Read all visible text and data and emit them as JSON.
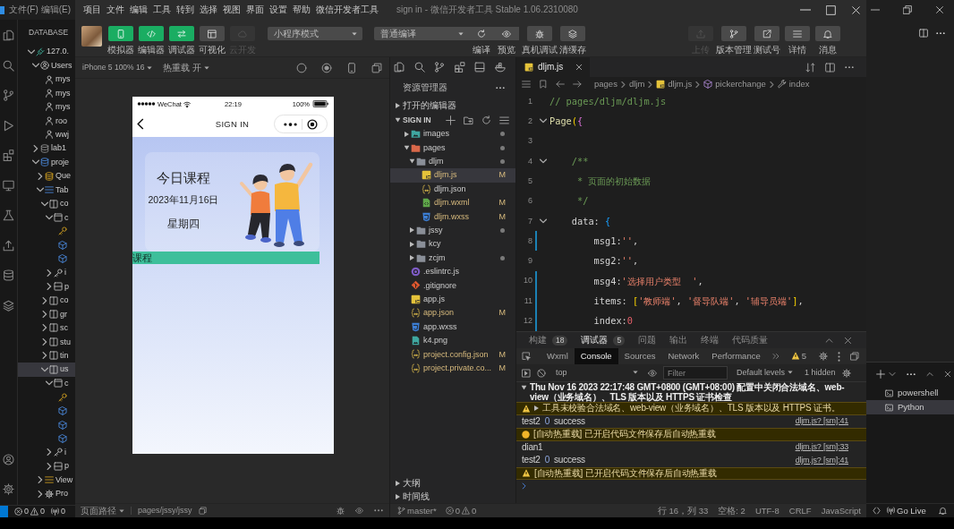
{
  "vscode": {
    "menu": [
      "文件(F)",
      "编辑(E)"
    ],
    "sidebar": {
      "title": "DATABASE",
      "tree": [
        {
          "label": "127.0.",
          "kind": "server",
          "expanded": true,
          "selected": false,
          "children": [
            {
              "label": "Users",
              "kind": "users",
              "expanded": true,
              "selected": false,
              "children": [
                {
                  "label": "mys",
                  "kind": "user",
                  "selected": false
                },
                {
                  "label": "mys",
                  "kind": "user",
                  "selected": false
                },
                {
                  "label": "mys",
                  "kind": "user",
                  "selected": false
                },
                {
                  "label": "roo",
                  "kind": "user",
                  "selected": false
                },
                {
                  "label": "wwj",
                  "kind": "user",
                  "selected": false
                }
              ]
            },
            {
              "label": "lab1",
              "kind": "database",
              "expanded": false,
              "selected": false
            },
            {
              "label": "proje",
              "kind": "schema",
              "expanded": true,
              "selected": false,
              "children": [
                {
                  "label": "Que",
                  "kind": "queries",
                  "expanded": false,
                  "selected": false
                },
                {
                  "label": "Tab",
                  "kind": "tables",
                  "expanded": true,
                  "selected": false,
                  "children": [
                    {
                      "label": "co",
                      "kind": "table",
                      "expanded": true,
                      "selected": false,
                      "children": [
                        {
                          "label": "c",
                          "kind": "columns",
                          "expanded": true,
                          "selected": false,
                          "children": [
                            {
                              "kind": "key",
                              "selected": false
                            },
                            {
                              "kind": "column",
                              "selected": false
                            },
                            {
                              "kind": "column",
                              "selected": false
                            }
                          ]
                        },
                        {
                          "label": "i",
                          "kind": "index",
                          "expanded": false,
                          "selected": false
                        },
                        {
                          "label": "p",
                          "kind": "partition",
                          "expanded": false,
                          "selected": false
                        }
                      ]
                    },
                    {
                      "label": "co",
                      "kind": "table",
                      "expanded": false,
                      "selected": false
                    },
                    {
                      "label": "gr",
                      "kind": "table",
                      "expanded": false,
                      "selected": false
                    },
                    {
                      "label": "sc",
                      "kind": "table",
                      "expanded": false,
                      "selected": false
                    },
                    {
                      "label": "stu",
                      "kind": "table",
                      "expanded": false,
                      "selected": false
                    },
                    {
                      "label": "tin",
                      "kind": "table",
                      "expanded": false,
                      "selected": false
                    },
                    {
                      "label": "us",
                      "kind": "table",
                      "expanded": true,
                      "selected": true,
                      "children": [
                        {
                          "label": "c",
                          "kind": "columns",
                          "expanded": true,
                          "selected": false,
                          "children": [
                            {
                              "kind": "key",
                              "selected": false
                            },
                            {
                              "kind": "column",
                              "selected": false
                            },
                            {
                              "kind": "column",
                              "selected": false
                            },
                            {
                              "kind": "column",
                              "selected": false
                            }
                          ]
                        },
                        {
                          "label": "i",
                          "kind": "index",
                          "expanded": false,
                          "selected": false
                        },
                        {
                          "label": "p",
                          "kind": "partition",
                          "expanded": false,
                          "selected": false
                        }
                      ]
                    }
                  ]
                },
                {
                  "label": "View",
                  "kind": "views",
                  "expanded": false,
                  "selected": false
                },
                {
                  "label": "Pro",
                  "kind": "procedures",
                  "expanded": false,
                  "selected": false
                }
              ]
            }
          ]
        }
      ]
    },
    "status": {
      "errors": "0",
      "warnings": "0",
      "ports": "0"
    },
    "panel": {
      "terminals": [
        {
          "label": "powershell",
          "selected": false
        },
        {
          "label": "Python",
          "selected": true
        }
      ]
    },
    "go_live": "Go Live"
  },
  "devtools": {
    "menu": [
      "项目",
      "文件",
      "编辑",
      "工具",
      "转到",
      "选择",
      "视图",
      "界面",
      "设置",
      "帮助",
      "微信开发者工具"
    ],
    "title": "sign in - 微信开发者工具 Stable 1.06.2310080",
    "toolbar": {
      "views": [
        {
          "label": "模拟器",
          "kind": "phone",
          "on": true,
          "disabled": false
        },
        {
          "label": "编辑器",
          "kind": "code",
          "on": true,
          "disabled": false
        },
        {
          "label": "调试器",
          "kind": "debug",
          "on": true,
          "disabled": false
        },
        {
          "label": "可视化",
          "kind": "layout",
          "on": false,
          "disabled": false
        },
        {
          "label": "云开发",
          "kind": "cloud",
          "on": false,
          "disabled": true
        }
      ],
      "mode": "小程序模式",
      "compile": {
        "label": "普通编译",
        "actions": [
          {
            "label": "编译",
            "kind": "refresh"
          },
          {
            "label": "预览",
            "kind": "eye"
          }
        ]
      },
      "actions": [
        {
          "label": "真机调试",
          "kind": "bug"
        },
        {
          "label": "清缓存",
          "kind": "layers"
        }
      ],
      "right": [
        {
          "label": "上传",
          "kind": "upload",
          "disabled": true
        },
        {
          "label": "版本管理",
          "kind": "branch",
          "disabled": false
        },
        {
          "label": "测试号",
          "kind": "share",
          "disabled": false
        },
        {
          "label": "详情",
          "kind": "menu",
          "disabled": false
        },
        {
          "label": "消息",
          "kind": "bell",
          "disabled": false
        }
      ]
    },
    "simulator": {
      "device": "iPhone 5 100% 16",
      "hot_reload": "热重载 开",
      "phone": {
        "carrier": "WeChat",
        "time": "22:19",
        "battery": "100%",
        "title": "SIGN IN",
        "card": {
          "title": "今日课程",
          "date": "2023年11月16日",
          "weekday": "星期四"
        },
        "section": "课程"
      },
      "footer": {
        "label": "页面路径",
        "path": "pages/jssy/jssy"
      }
    },
    "explorer": {
      "title": "资源管理器",
      "open_editors": {
        "label": "打开的编辑器",
        "expanded": false
      },
      "project": {
        "label": "SIGN IN",
        "expanded": true,
        "tree": [
          {
            "label": "images",
            "kind": "assets",
            "expanded": false,
            "selected": false,
            "dot": true
          },
          {
            "label": "pages",
            "kind": "pages",
            "expanded": true,
            "selected": false,
            "dot": true,
            "children": [
              {
                "label": "dljm",
                "kind": "folder",
                "expanded": true,
                "selected": false,
                "dot": true,
                "children": [
                  {
                    "label": "dljm.js",
                    "kind": "js",
                    "selected": true,
                    "dot": false,
                    "status": "M"
                  },
                  {
                    "label": "dljm.json",
                    "kind": "json",
                    "selected": false,
                    "dot": false
                  },
                  {
                    "label": "dljm.wxml",
                    "kind": "wxml",
                    "selected": false,
                    "dot": false,
                    "status": "M"
                  },
                  {
                    "label": "dljm.wxss",
                    "kind": "wxss",
                    "selected": false,
                    "dot": false,
                    "status": "M"
                  }
                ]
              },
              {
                "label": "jssy",
                "kind": "folder",
                "expanded": false,
                "selected": false,
                "dot": true
              },
              {
                "label": "kcy",
                "kind": "folder",
                "expanded": false,
                "selected": false,
                "dot": false
              },
              {
                "label": "zcjm",
                "kind": "folder",
                "expanded": false,
                "selected": false,
                "dot": true
              }
            ]
          },
          {
            "label": ".eslintrc.js",
            "kind": "eslint",
            "selected": false,
            "dot": false
          },
          {
            "label": ".gitignore",
            "kind": "git",
            "selected": false,
            "dot": false
          },
          {
            "label": "app.js",
            "kind": "js",
            "selected": false,
            "dot": false
          },
          {
            "label": "app.json",
            "kind": "json",
            "selected": false,
            "dot": false,
            "status": "M"
          },
          {
            "label": "app.wxss",
            "kind": "wxss",
            "selected": false,
            "dot": false
          },
          {
            "label": "k4.png",
            "kind": "png",
            "selected": false,
            "dot": false
          },
          {
            "label": "project.config.json",
            "kind": "json",
            "selected": false,
            "dot": false,
            "status": "M"
          },
          {
            "label": "project.private.co...",
            "kind": "json",
            "selected": false,
            "dot": false,
            "status": "M"
          }
        ]
      },
      "outline": {
        "label": "大纲",
        "expanded": false
      },
      "timeline": {
        "label": "时间线",
        "expanded": false
      }
    },
    "editor": {
      "tab": {
        "label": "dljm.js",
        "kind": "js",
        "selected": true
      },
      "breadcrumb": [
        {
          "label": "pages",
          "kind": "folder"
        },
        {
          "label": "dljm",
          "kind": "folder"
        },
        {
          "label": "dljm.js",
          "kind": "js"
        },
        {
          "label": "pickerchange",
          "kind": "method"
        },
        {
          "label": "index",
          "kind": "property"
        }
      ],
      "lines": [
        {
          "number": "1",
          "fold": false,
          "changed": false,
          "tokens": [
            {
              "kind": "comment",
              "text": "// pages/dljm/dljm.js"
            }
          ]
        },
        {
          "number": "2",
          "fold": true,
          "changed": false,
          "tokens": [
            {
              "kind": "function",
              "text": "Page"
            },
            {
              "kind": "bracket1",
              "text": "("
            },
            {
              "kind": "bracket2",
              "text": "{"
            }
          ]
        },
        {
          "number": "3",
          "fold": false,
          "changed": false
        },
        {
          "number": "4",
          "fold": true,
          "changed": false,
          "tokens": [
            {
              "kind": "comment",
              "text": "    /**"
            }
          ]
        },
        {
          "number": "5",
          "fold": false,
          "changed": false,
          "tokens": [
            {
              "kind": "comment",
              "text": "     * 页面的初始数据"
            }
          ]
        },
        {
          "number": "6",
          "fold": false,
          "changed": false,
          "tokens": [
            {
              "kind": "comment",
              "text": "     */"
            }
          ]
        },
        {
          "number": "7",
          "fold": true,
          "changed": false,
          "tokens": [
            {
              "kind": "property",
              "text": "    data"
            },
            {
              "kind": "punctuation",
              "text": ": "
            },
            {
              "kind": "bracket3",
              "text": "{"
            }
          ]
        },
        {
          "number": "8",
          "fold": false,
          "changed": true,
          "tokens": [
            {
              "kind": "property",
              "text": "        msg1"
            },
            {
              "kind": "punctuation",
              "text": ":"
            },
            {
              "kind": "string",
              "text": "''"
            },
            {
              "kind": "punctuation",
              "text": ","
            }
          ]
        },
        {
          "number": "9",
          "fold": false,
          "changed": false,
          "tokens": [
            {
              "kind": "property",
              "text": "        msg2"
            },
            {
              "kind": "punctuation",
              "text": ":"
            },
            {
              "kind": "string",
              "text": "''"
            },
            {
              "kind": "punctuation",
              "text": ","
            }
          ]
        },
        {
          "number": "10",
          "fold": false,
          "changed": true,
          "tokens": [
            {
              "kind": "property",
              "text": "        msg4"
            },
            {
              "kind": "punctuation",
              "text": ":"
            },
            {
              "kind": "string",
              "text": "'选择用户类型  '"
            },
            {
              "kind": "punctuation",
              "text": ","
            }
          ]
        },
        {
          "number": "11",
          "fold": false,
          "changed": true,
          "tokens": [
            {
              "kind": "property",
              "text": "        items"
            },
            {
              "kind": "punctuation",
              "text": ": "
            },
            {
              "kind": "bracket1",
              "text": "["
            },
            {
              "kind": "string",
              "text": "'教师端'"
            },
            {
              "kind": "punctuation",
              "text": ", "
            },
            {
              "kind": "string",
              "text": "'督导队端'"
            },
            {
              "kind": "punctuation",
              "text": ", "
            },
            {
              "kind": "string",
              "text": "'辅导员端'"
            },
            {
              "kind": "bracket1",
              "text": "]"
            },
            {
              "kind": "punctuation",
              "text": ","
            }
          ]
        },
        {
          "number": "12",
          "fold": false,
          "changed": true,
          "tokens": [
            {
              "kind": "property",
              "text": "        index"
            },
            {
              "kind": "punctuation",
              "text": ":"
            },
            {
              "kind": "number",
              "text": "0"
            }
          ]
        }
      ]
    },
    "panel": {
      "tabs": [
        {
          "label": "构建",
          "count": "18",
          "selected": false
        },
        {
          "label": "调试器",
          "count": "5",
          "selected": true
        },
        {
          "label": "问题",
          "selected": false
        },
        {
          "label": "输出",
          "selected": false
        },
        {
          "label": "终端",
          "selected": false
        },
        {
          "label": "代码质量",
          "selected": false
        }
      ],
      "devtools_tabs": [
        {
          "label": "Wxml",
          "selected": false
        },
        {
          "label": "Console",
          "selected": true
        },
        {
          "label": "Sources",
          "selected": false
        },
        {
          "label": "Network",
          "selected": false
        },
        {
          "label": "Performance",
          "selected": false
        }
      ],
      "warnings": "5",
      "filter": {
        "context": "top",
        "placeholder": "Filter",
        "levels": "Default levels",
        "hidden": "1 hidden"
      },
      "console": [
        {
          "kind": "group",
          "expanded": true,
          "text": "Thu Nov 16 2023 22:17:48 GMT+0800 (GMT+08:00) 配置中关闭合法域名、web-view（业务域名）、TLS 版本以及 HTTPS 证书检查"
        },
        {
          "kind": "warning",
          "expanded": false,
          "text": "工具未校验合法域名、web-view（业务域名）、TLS 版本以及 HTTPS 证书。"
        },
        {
          "kind": "log",
          "args": [
            {
              "kind": "string",
              "text": "test2"
            },
            {
              "kind": "number",
              "text": "0"
            },
            {
              "kind": "string",
              "text": "success"
            }
          ],
          "source": "dljm.js? [sm]:41"
        },
        {
          "kind": "notice",
          "text": "[自动热重载] 已开启代码文件保存后自动热重载"
        },
        {
          "kind": "log",
          "args": [
            {
              "kind": "string",
              "text": "dian1"
            }
          ],
          "source": "dljm.js? [sm]:33"
        },
        {
          "kind": "log",
          "args": [
            {
              "kind": "string",
              "text": "test2"
            },
            {
              "kind": "number",
              "text": "0"
            },
            {
              "kind": "string",
              "text": "success"
            }
          ],
          "source": "dljm.js? [sm]:41"
        },
        {
          "kind": "warning",
          "text": "[自动热重载] 已开启代码文件保存后自动热重载"
        }
      ]
    },
    "status_bar": {
      "branch": "master*",
      "errors": "0",
      "warnings": "0",
      "items": [
        "行 16，列 33",
        "空格: 2",
        "UTF-8",
        "CRLF",
        "JavaScript"
      ]
    }
  }
}
